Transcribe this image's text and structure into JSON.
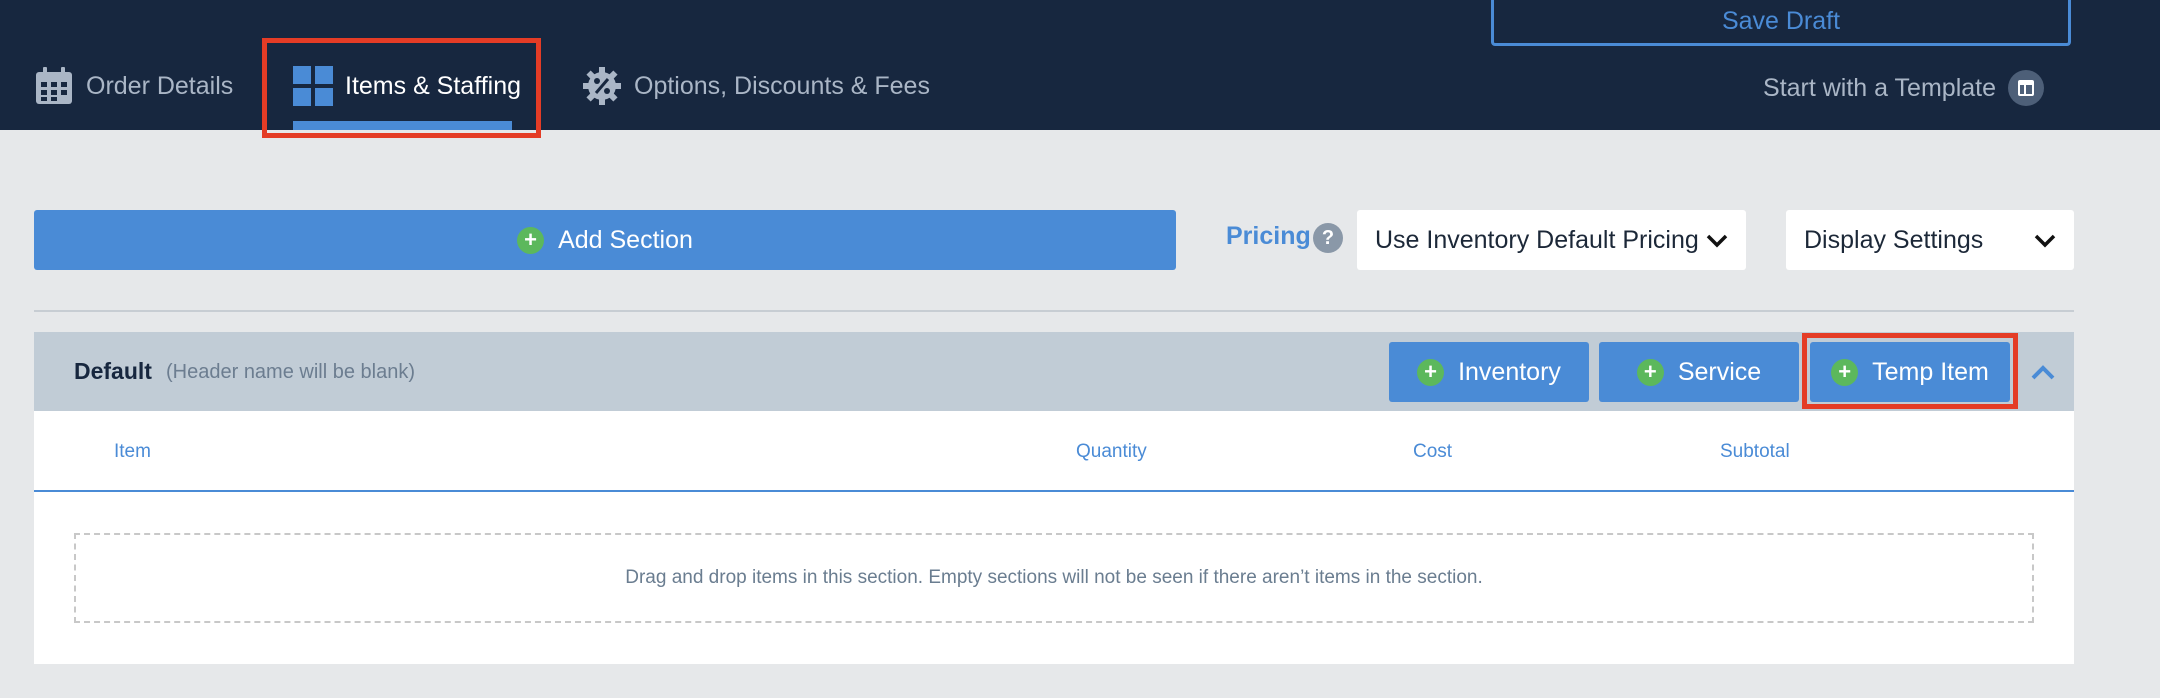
{
  "header": {
    "save_draft": "Save Draft",
    "tabs": [
      {
        "label": "Order Details",
        "icon": "calendar-icon"
      },
      {
        "label": "Items & Staffing",
        "icon": "grid-icon",
        "active": true
      },
      {
        "label": "Options, Discounts & Fees",
        "icon": "percent-gear-icon"
      }
    ],
    "template_link": "Start with a Template"
  },
  "toolbar": {
    "add_section": "Add Section",
    "pricing_label": "Pricing",
    "help": "?",
    "pricing_select": "Use Inventory Default Pricing",
    "display_settings": "Display Settings"
  },
  "section": {
    "title": "Default",
    "subtitle": "(Header name will be blank)",
    "buttons": {
      "inventory": "Inventory",
      "service": "Service",
      "temp_item": "Temp Item"
    },
    "columns": [
      "Item",
      "Quantity",
      "Cost",
      "Subtotal"
    ],
    "empty_message": "Drag and drop items in this section. Empty sections will not be seen if there aren’t items in the section."
  },
  "colors": {
    "navbar": "#17273f",
    "accent": "#4a8bd6",
    "highlight": "#e43c26",
    "plus_green": "#5cb85c",
    "page_bg": "#e6e8ea"
  }
}
